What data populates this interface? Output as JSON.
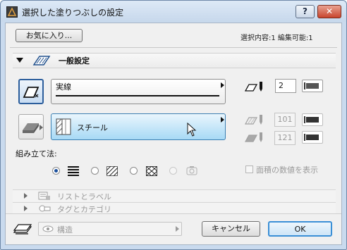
{
  "window": {
    "title": "選択した塗りつぶしの設定",
    "help_button": "?",
    "close_button": "✕"
  },
  "toolbar": {
    "favorites_button": "お気に入り...",
    "selection_info": "選択内容:1 編集可能:1"
  },
  "general_panel": {
    "title": "一般設定",
    "fill_type": {
      "label": "実線",
      "icon": "solid-fill-icon"
    },
    "surface": {
      "label": "スチール",
      "icon": "surface-material-icon"
    },
    "fill_pen": {
      "icon": "fill-pen-icon",
      "value": "2"
    },
    "foreground_pen": {
      "icon": "foreground-pen-icon",
      "value": "101"
    },
    "background_pen": {
      "icon": "background-pen-icon",
      "value": "121"
    },
    "construction_method": {
      "label": "組み立て法:",
      "options": [
        {
          "name": "solid-hatch-pattern",
          "selected": true,
          "enabled": true
        },
        {
          "name": "diagonal-hatch-pattern",
          "selected": false,
          "enabled": true
        },
        {
          "name": "cross-hatch-pattern",
          "selected": false,
          "enabled": true
        },
        {
          "name": "image-fill-pattern",
          "selected": false,
          "enabled": false
        }
      ]
    },
    "show_area_checkbox": {
      "label": "面積の数値を表示",
      "checked": false,
      "enabled": false
    }
  },
  "collapsed_panels": [
    {
      "label": "リストとラベル",
      "icon": "list-label-icon"
    },
    {
      "label": "タグとカテゴリ",
      "icon": "tag-category-icon"
    }
  ],
  "footer": {
    "layer_icon": "layer-icon",
    "layer_value": "構造",
    "cancel_button": "キャンセル",
    "ok_button": "OK"
  },
  "colors": {
    "accent_blue": "#2c5e9c",
    "selected_dropdown": "#a7d9f5",
    "window_frame": "#c9daee",
    "close_red": "#c8452d"
  }
}
